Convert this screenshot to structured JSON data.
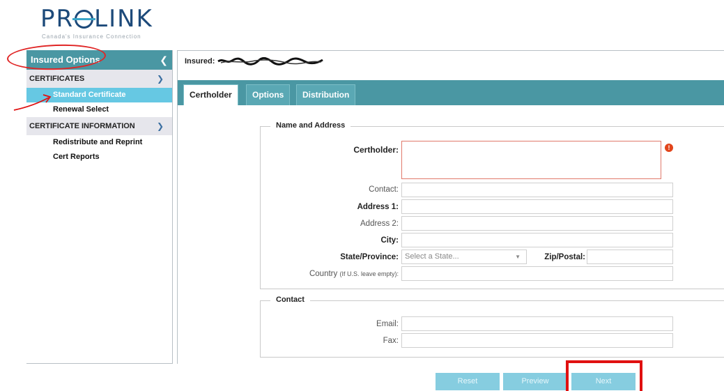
{
  "logo": {
    "text_pre": "PR",
    "text_post": "LINK",
    "tagline": "Canada's Insurance Connection"
  },
  "sidebar": {
    "title": "Insured Options",
    "collapse_icon": "chevron-left-icon",
    "sections": [
      {
        "label": "CERTIFICATES",
        "items": [
          "Standard Certificate",
          "Renewal Select"
        ]
      },
      {
        "label": "CERTIFICATE INFORMATION",
        "items": [
          "Redistribute and Reprint",
          "Cert Reports"
        ]
      }
    ],
    "active_item": "Standard Certificate"
  },
  "main": {
    "insured_label": "Insured:",
    "tabs": [
      "Certholder",
      "Options",
      "Distribution"
    ],
    "active_tab": "Certholder",
    "name_address": {
      "legend": "Name and Address",
      "certholder_label": "Certholder:",
      "contact_label": "Contact:",
      "address1_label": "Address 1:",
      "address2_label": "Address 2:",
      "city_label": "City:",
      "state_label": "State/Province:",
      "state_placeholder": "Select a State...",
      "zip_label": "Zip/Postal:",
      "country_label": "Country",
      "country_hint": "(If U.S. leave empty):",
      "error_icon": "!"
    },
    "contact": {
      "legend": "Contact",
      "email_label": "Email:",
      "fax_label": "Fax:"
    }
  },
  "buttons": {
    "reset": "Reset",
    "preview": "Preview",
    "next": "Next"
  },
  "colors": {
    "teal": "#4a97a3",
    "active_item": "#66c8e3",
    "button": "#86cde0",
    "annotation_red": "#e01010",
    "error": "#e2451b"
  }
}
